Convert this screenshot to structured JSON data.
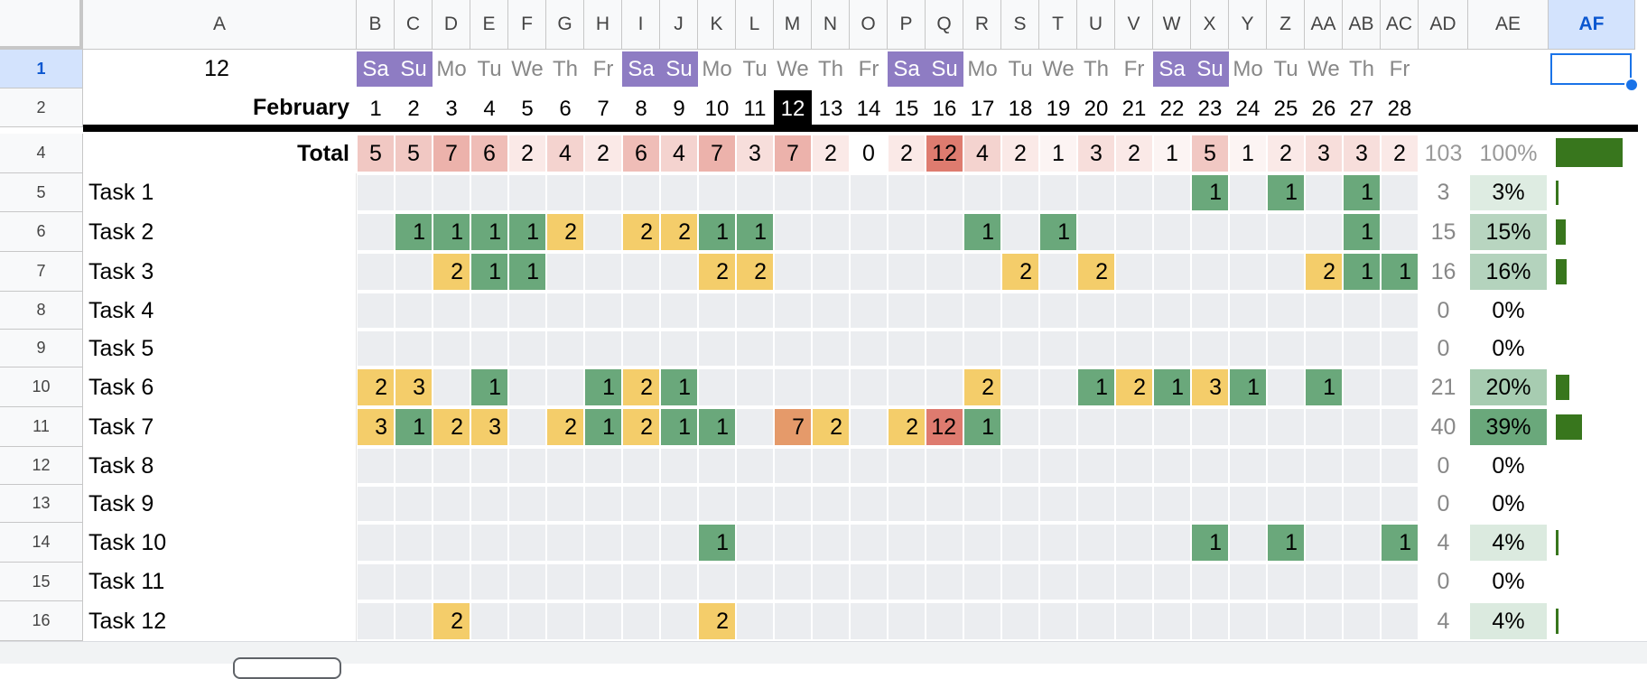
{
  "colors": {
    "weekend": "#8e7cc3",
    "today": "#000000",
    "cell_empty": "#ebedf0",
    "green": "#6aa87b",
    "yellow": "#f4cd6a",
    "orange": "#e59a6a",
    "red": "#de7b6f",
    "bar": "#38761d",
    "pct_shade": "#b7e1cd"
  },
  "columns": [
    "A",
    "B",
    "C",
    "D",
    "E",
    "F",
    "G",
    "H",
    "I",
    "J",
    "K",
    "L",
    "M",
    "N",
    "O",
    "P",
    "Q",
    "R",
    "S",
    "T",
    "U",
    "V",
    "W",
    "X",
    "Y",
    "Z",
    "AA",
    "AB",
    "AC",
    "AD",
    "AE",
    "AF"
  ],
  "selected_column": "AF",
  "rows": [
    {
      "num": "1",
      "selected": true
    },
    {
      "num": "2"
    },
    {
      "num": "4"
    },
    {
      "num": "5"
    },
    {
      "num": "6"
    },
    {
      "num": "7"
    },
    {
      "num": "8"
    },
    {
      "num": "9"
    },
    {
      "num": "10"
    },
    {
      "num": "11"
    },
    {
      "num": "12"
    },
    {
      "num": "13"
    },
    {
      "num": "14"
    },
    {
      "num": "15"
    },
    {
      "num": "16"
    }
  ],
  "header": {
    "day_index": "12",
    "month": "February",
    "today": 12,
    "weekdays": [
      "Sa",
      "Su",
      "Mo",
      "Tu",
      "We",
      "Th",
      "Fr",
      "Sa",
      "Su",
      "Mo",
      "Tu",
      "We",
      "Th",
      "Fr",
      "Sa",
      "Su",
      "Mo",
      "Tu",
      "We",
      "Th",
      "Fr",
      "Sa",
      "Su",
      "Mo",
      "Tu",
      "We",
      "Th",
      "Fr"
    ],
    "dates": [
      "1",
      "2",
      "3",
      "4",
      "5",
      "6",
      "7",
      "8",
      "9",
      "10",
      "11",
      "12",
      "13",
      "14",
      "15",
      "16",
      "17",
      "18",
      "19",
      "20",
      "21",
      "22",
      "23",
      "24",
      "25",
      "26",
      "27",
      "28"
    ]
  },
  "totals": {
    "label": "Total",
    "daily": [
      "5",
      "5",
      "7",
      "6",
      "2",
      "4",
      "2",
      "6",
      "4",
      "7",
      "3",
      "7",
      "2",
      "0",
      "2",
      "12",
      "4",
      "2",
      "1",
      "3",
      "2",
      "1",
      "5",
      "1",
      "2",
      "3",
      "3",
      "2"
    ],
    "sum": "103",
    "pct": "100%",
    "fraction": 1.0
  },
  "tasks": [
    {
      "name": "Task 1",
      "values": [
        "",
        "",
        "",
        "",
        "",
        "",
        "",
        "",
        "",
        "",
        "",
        "",
        "",
        "",
        "",
        "",
        "",
        "",
        "",
        "",
        "",
        "",
        "1",
        "",
        "1",
        "",
        "1",
        ""
      ],
      "sum": "3",
      "pct": "3%",
      "fraction": 0.03
    },
    {
      "name": "Task 2",
      "values": [
        "",
        "1",
        "1",
        "1",
        "1",
        "2",
        "",
        "2",
        "2",
        "1",
        "1",
        "",
        "",
        "",
        "",
        "",
        "1",
        "",
        "1",
        "",
        "",
        "",
        "",
        "",
        "",
        "",
        "1",
        ""
      ],
      "sum": "15",
      "pct": "15%",
      "fraction": 0.15
    },
    {
      "name": "Task 3",
      "values": [
        "",
        "",
        "2",
        "1",
        "1",
        "",
        "",
        "",
        "",
        "2",
        "2",
        "",
        "",
        "",
        "",
        "",
        "",
        "2",
        "",
        "2",
        "",
        "",
        "",
        "",
        "",
        "2",
        "1",
        "1"
      ],
      "sum": "16",
      "pct": "16%",
      "fraction": 0.16
    },
    {
      "name": "Task 4",
      "values": [
        "",
        "",
        "",
        "",
        "",
        "",
        "",
        "",
        "",
        "",
        "",
        "",
        "",
        "",
        "",
        "",
        "",
        "",
        "",
        "",
        "",
        "",
        "",
        "",
        "",
        "",
        "",
        ""
      ],
      "sum": "0",
      "pct": "0%",
      "fraction": 0
    },
    {
      "name": "Task 5",
      "values": [
        "",
        "",
        "",
        "",
        "",
        "",
        "",
        "",
        "",
        "",
        "",
        "",
        "",
        "",
        "",
        "",
        "",
        "",
        "",
        "",
        "",
        "",
        "",
        "",
        "",
        "",
        "",
        ""
      ],
      "sum": "0",
      "pct": "0%",
      "fraction": 0
    },
    {
      "name": "Task 6",
      "values": [
        "2",
        "3",
        "",
        "1",
        "",
        "",
        "1",
        "2",
        "1",
        "",
        "",
        "",
        "",
        "",
        "",
        "",
        "2",
        "",
        "",
        "1",
        "2",
        "1",
        "3",
        "1",
        "",
        "1",
        "",
        ""
      ],
      "sum": "21",
      "pct": "20%",
      "fraction": 0.2
    },
    {
      "name": "Task 7",
      "values": [
        "3",
        "1",
        "2",
        "3",
        "",
        "2",
        "1",
        "2",
        "1",
        "1",
        "",
        "7",
        "2",
        "",
        "2",
        "12",
        "1",
        "",
        "",
        "",
        "",
        "",
        "",
        "",
        "",
        "",
        "",
        ""
      ],
      "sum": "40",
      "pct": "39%",
      "fraction": 0.39
    },
    {
      "name": "Task 8",
      "values": [
        "",
        "",
        "",
        "",
        "",
        "",
        "",
        "",
        "",
        "",
        "",
        "",
        "",
        "",
        "",
        "",
        "",
        "",
        "",
        "",
        "",
        "",
        "",
        "",
        "",
        "",
        "",
        ""
      ],
      "sum": "0",
      "pct": "0%",
      "fraction": 0
    },
    {
      "name": "Task 9",
      "values": [
        "",
        "",
        "",
        "",
        "",
        "",
        "",
        "",
        "",
        "",
        "",
        "",
        "",
        "",
        "",
        "",
        "",
        "",
        "",
        "",
        "",
        "",
        "",
        "",
        "",
        "",
        "",
        ""
      ],
      "sum": "0",
      "pct": "0%",
      "fraction": 0
    },
    {
      "name": "Task 10",
      "values": [
        "",
        "",
        "",
        "",
        "",
        "",
        "",
        "",
        "",
        "1",
        "",
        "",
        "",
        "",
        "",
        "",
        "",
        "",
        "",
        "",
        "",
        "",
        "1",
        "",
        "1",
        "",
        "",
        "1"
      ],
      "sum": "4",
      "pct": "4%",
      "fraction": 0.04
    },
    {
      "name": "Task 11",
      "values": [
        "",
        "",
        "",
        "",
        "",
        "",
        "",
        "",
        "",
        "",
        "",
        "",
        "",
        "",
        "",
        "",
        "",
        "",
        "",
        "",
        "",
        "",
        "",
        "",
        "",
        "",
        "",
        ""
      ],
      "sum": "0",
      "pct": "0%",
      "fraction": 0
    },
    {
      "name": "Task 12",
      "values": [
        "",
        "",
        "2",
        "",
        "",
        "",
        "",
        "",
        "",
        "2",
        "",
        "",
        "",
        "",
        "",
        "",
        "",
        "",
        "",
        "",
        "",
        "",
        "",
        "",
        "",
        "",
        "",
        ""
      ],
      "sum": "4",
      "pct": "4%",
      "fraction": 0.04
    }
  ]
}
